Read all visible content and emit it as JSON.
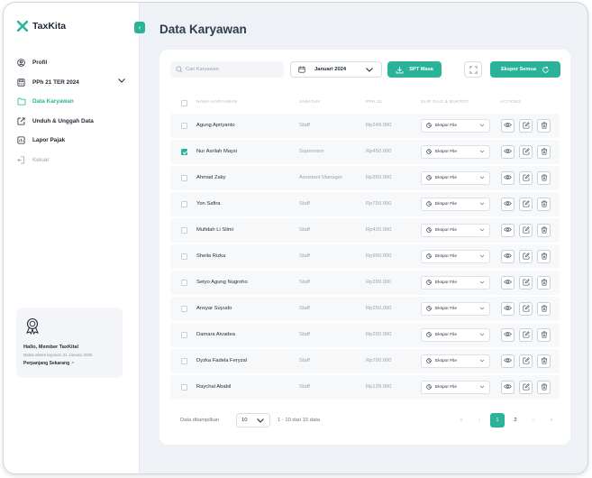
{
  "app": {
    "name": "TaxKita"
  },
  "sidebar": {
    "items": [
      {
        "label": "Profil",
        "icon": "user-icon"
      },
      {
        "label": "PPh 21 TER 2024",
        "icon": "calculator-icon"
      },
      {
        "label": "Data Karyawan",
        "icon": "folder-icon",
        "active": true
      },
      {
        "label": "Unduh & Unggah Data",
        "icon": "upload-icon"
      },
      {
        "label": "Lapor Pajak",
        "icon": "report-icon"
      },
      {
        "label": "Keluar",
        "icon": "logout-icon"
      }
    ],
    "promo": {
      "title": "Hallo, Member TaxKita!",
      "subtitle": "Batas akses layanan 31 Januari 2025",
      "link": "Perpanjang Sekarang"
    }
  },
  "main": {
    "title": "Data Karyawan",
    "toolbar": {
      "search_placeholder": "Cari Karyawan",
      "period": "Januari 2024",
      "spt_label": "SPT Masa",
      "export_label": "Ekspor Semua"
    },
    "table": {
      "columns": [
        "NAMA KARYAWAN",
        "JABATAN",
        "PPH 21",
        "SLIP GAJI & BUKPOT",
        "ACTIONS"
      ],
      "slip_label": "Ekspor File",
      "rows": [
        {
          "name": "Agung Apriyanto",
          "job": "Staff",
          "pph": "Rp249.000",
          "checked": false
        },
        {
          "name": "Nur Asrilah Maysi",
          "job": "Supervisor",
          "pph": "Rp450.000",
          "checked": true
        },
        {
          "name": "Ahmad Zaky",
          "job": "Assistant Manager",
          "pph": "Rp350.000",
          "checked": false
        },
        {
          "name": "Yon Safira",
          "job": "Staff",
          "pph": "Rp750.000",
          "checked": false
        },
        {
          "name": "Mufidah Li Silmi",
          "job": "Staff",
          "pph": "Rp420.000",
          "checked": false
        },
        {
          "name": "Sheila Rizka",
          "job": "Staff",
          "pph": "Rp999.000",
          "checked": false
        },
        {
          "name": "Setyo Agung Nugroho",
          "job": "Staff",
          "pph": "Rp399.000",
          "checked": false
        },
        {
          "name": "Ansyar Suyudo",
          "job": "Staff",
          "pph": "Rp250.000",
          "checked": false
        },
        {
          "name": "Damara Aivadea",
          "job": "Staff",
          "pph": "Rp200.000",
          "checked": false
        },
        {
          "name": "Dyzka Fadela Feryzal",
          "job": "Staff",
          "pph": "Rp790.000",
          "checked": false
        },
        {
          "name": "Raychal Ababil",
          "job": "Staff",
          "pph": "Rp128.000",
          "checked": false
        }
      ]
    },
    "footer": {
      "shown_label": "Data ditampilkan",
      "per_page": "10",
      "range": "1 - 10 dari 15 data",
      "pages": [
        "1",
        "2"
      ],
      "current_page": "1",
      "first": "«",
      "prev": "‹",
      "next": "›",
      "last": "»"
    }
  },
  "colors": {
    "accent": "#2bb39a",
    "background": "#eef2f6",
    "text": "#1f2a37"
  }
}
